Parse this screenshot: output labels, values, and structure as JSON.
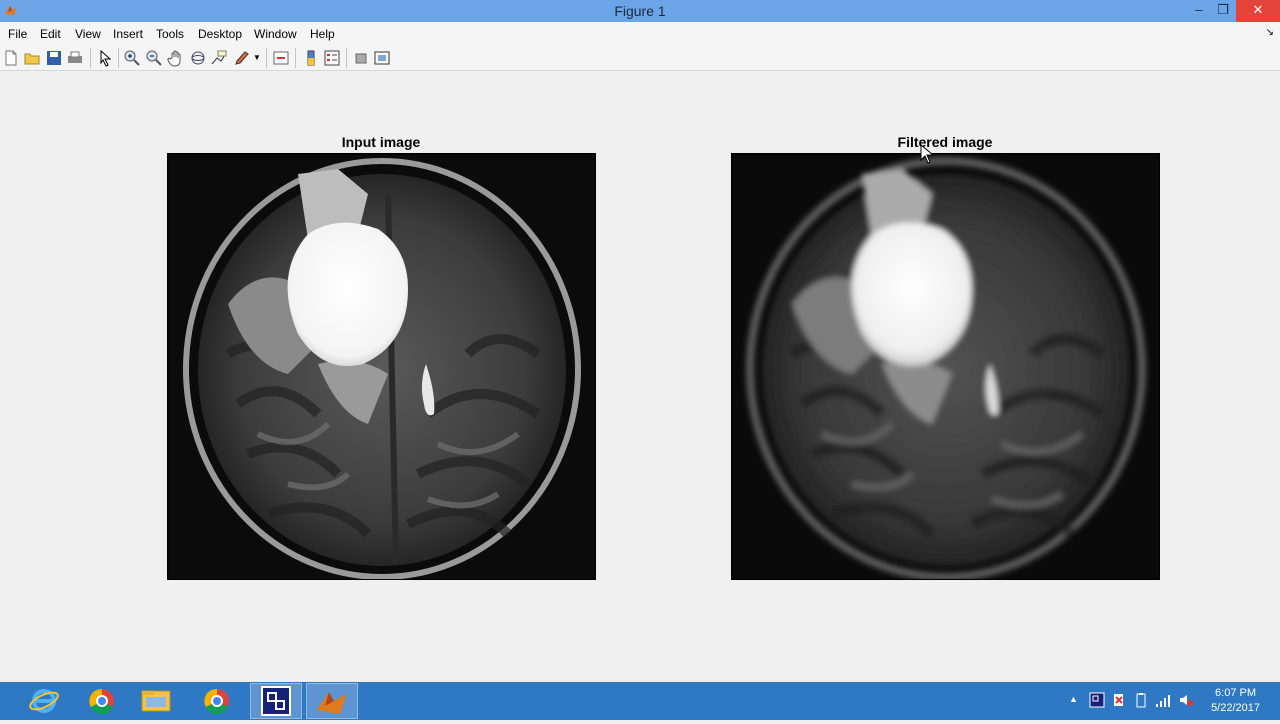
{
  "window": {
    "title": "Figure 1"
  },
  "menu": [
    "File",
    "Edit",
    "View",
    "Insert",
    "Tools",
    "Desktop",
    "Window",
    "Help"
  ],
  "toolbar": [
    "new-figure-icon",
    "open-file-icon",
    "save-icon",
    "print-icon",
    "edit-plot-icon",
    "zoom-in-icon",
    "zoom-out-icon",
    "pan-icon",
    "rotate-3d-icon",
    "data-cursor-icon",
    "brush-icon",
    "link-plot-icon",
    "colorbar-icon",
    "legend-icon",
    "hide-plot-tools-icon",
    "show-plot-tools-icon"
  ],
  "axes": [
    {
      "title": "Input image"
    },
    {
      "title": "Filtered image"
    }
  ],
  "taskbar": {
    "apps": [
      "internet-explorer-icon",
      "chrome-icon",
      "file-explorer-icon",
      "chrome-icon",
      "remote-app-icon",
      "matlab-icon"
    ],
    "time": "6:07 PM",
    "date": "5/22/2017"
  }
}
